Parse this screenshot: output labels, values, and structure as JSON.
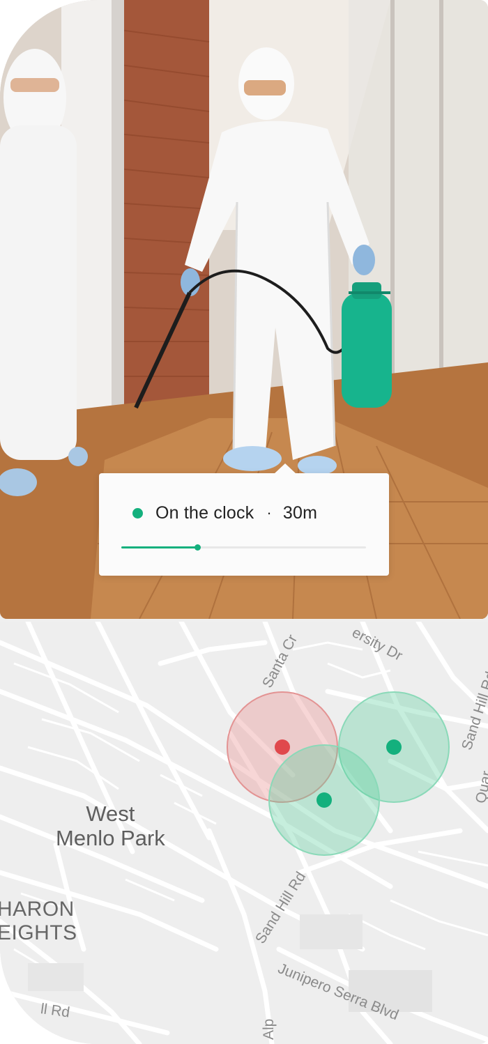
{
  "status": {
    "dot_color": "#14b07d",
    "label": "On the clock",
    "separator": "·",
    "duration": "30m",
    "progress_fraction": 0.31
  },
  "map": {
    "place_name_line1": "West",
    "place_name_line2": "Menlo Park",
    "area_label_line1": "HARON",
    "area_label_line2": "EIGHTS",
    "roads": {
      "santa_cruz": "Santa Cr",
      "university": "ersity Dr",
      "sand_hill_vertical": "Sand Hill Rd",
      "sand_hill_diagonal": "Sand Hill Rd",
      "junipero": "Junipero Serra Blvd",
      "quarry": "Quar",
      "alpine": "Alp",
      "bottom_left": "ll Rd"
    },
    "markers": [
      {
        "kind": "red",
        "color": "#e0484c"
      },
      {
        "kind": "green",
        "color": "#14b07d"
      },
      {
        "kind": "green",
        "color": "#14b07d"
      }
    ]
  }
}
